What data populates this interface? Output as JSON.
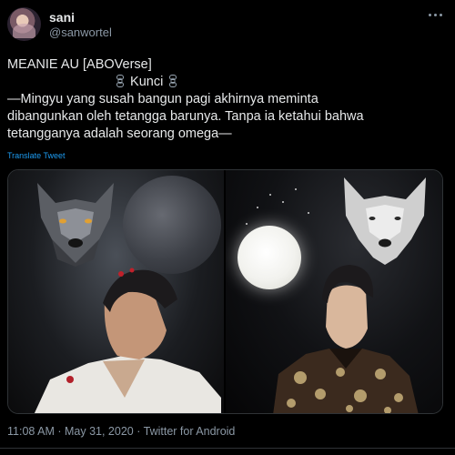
{
  "author": {
    "display_name": "sani",
    "handle": "@sanwortel"
  },
  "tweet": {
    "line1": "MEANIE  AU [ABOVerse]",
    "line2_label": "Kunci",
    "line3": "—Mingyu yang susah bangun pagi akhirnya meminta",
    "line4": "dibangunkan oleh tetangga barunya. Tanpa ia ketahui bahwa",
    "line5": "tetangganya adalah seorang omega—",
    "translate_label": "Translate Tweet"
  },
  "media": {
    "left_image": "photo-wolf-moon-man-looking-up",
    "right_image": "photo-white-wolf-full-moon-man"
  },
  "meta": {
    "time": "11:08 AM",
    "separator": " · ",
    "date": "May 31, 2020",
    "client": "Twitter for Android"
  },
  "icons": {
    "more": "more-horizontal-icon",
    "chain": "chain-link-icon"
  },
  "colors": {
    "background": "#000000",
    "text": "#e7e9ea",
    "secondary_text": "#8b98a5",
    "link": "#1d9bf0"
  }
}
